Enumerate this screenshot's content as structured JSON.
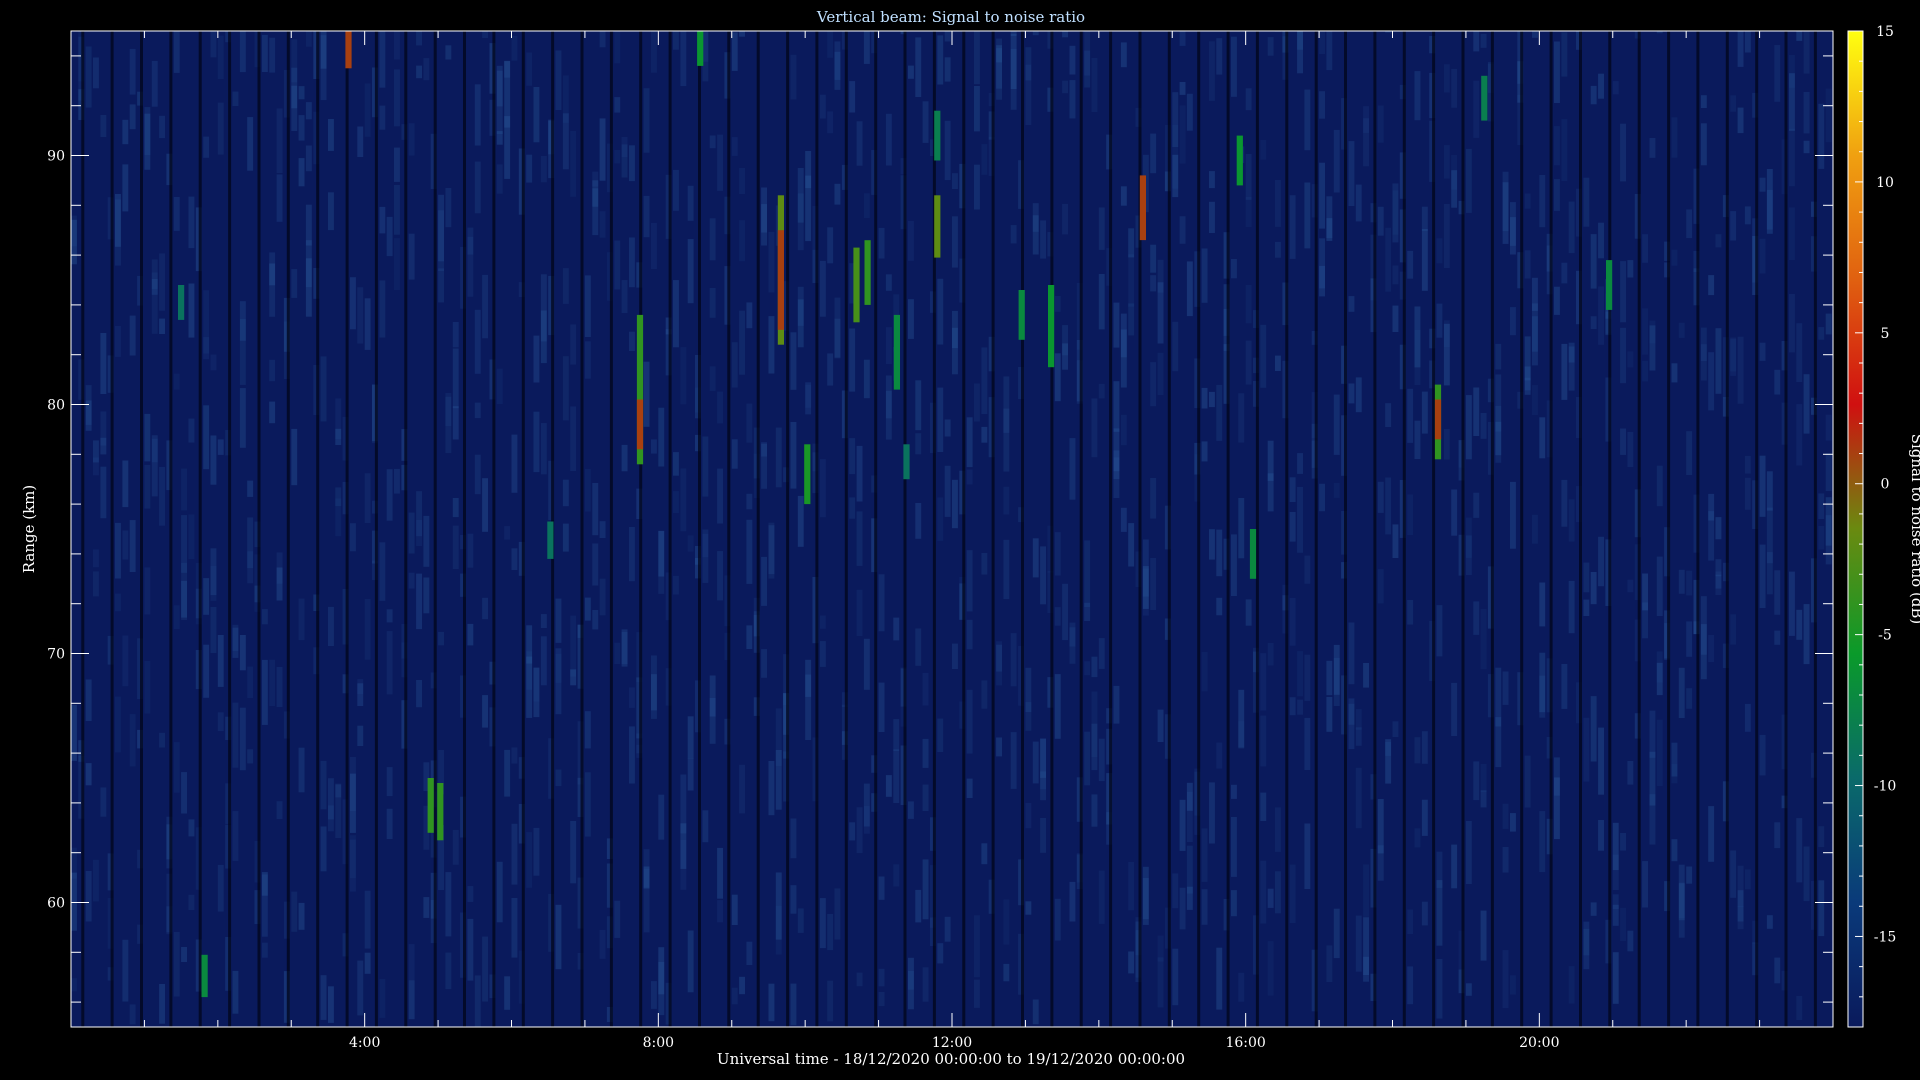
{
  "chart_data": {
    "type": "heatmap",
    "title": "Vertical beam: Signal to noise ratio",
    "xlabel": "Universal time - 18/12/2020 00:00:00 to 19/12/2020 00:00:00",
    "ylabel": "Range (km)",
    "colorbar_label": "Signal to noise ratio (dB)",
    "x_unit": "hours UT",
    "xlim": [
      0,
      24
    ],
    "ylim": [
      55,
      95
    ],
    "x_ticks": [
      {
        "value": 4,
        "label": "4:00"
      },
      {
        "value": 8,
        "label": "8:00"
      },
      {
        "value": 12,
        "label": "12:00"
      },
      {
        "value": 16,
        "label": "16:00"
      },
      {
        "value": 20,
        "label": "20:00"
      }
    ],
    "y_ticks": [
      {
        "value": 60,
        "label": "60"
      },
      {
        "value": 70,
        "label": "70"
      },
      {
        "value": 80,
        "label": "80"
      },
      {
        "value": 90,
        "label": "90"
      }
    ],
    "colorbar_range": [
      -18,
      15
    ],
    "colorbar_ticks": [
      {
        "value": 15,
        "label": "15"
      },
      {
        "value": 10,
        "label": "10"
      },
      {
        "value": 5,
        "label": "5"
      },
      {
        "value": 0,
        "label": "0"
      },
      {
        "value": -5,
        "label": "-5"
      },
      {
        "value": -10,
        "label": "-10"
      },
      {
        "value": -15,
        "label": "-15"
      }
    ],
    "colormap": [
      "#0a1a5c",
      "#0a3a7a",
      "#0a6a6a",
      "#0a9a2a",
      "#6a8a10",
      "#d01010",
      "#e06010",
      "#f0a010",
      "#ffff10"
    ],
    "colors": {
      "background": "#000000",
      "axes": "#ffffff",
      "title": "#c0e0ff",
      "base": "#0a1a5c"
    },
    "echoes": [
      {
        "time": 3.78,
        "range_min": 93.5,
        "range_max": 95.0,
        "snr_db": 1
      },
      {
        "time": 8.57,
        "range_min": 93.6,
        "range_max": 95.0,
        "snr_db": -6
      },
      {
        "time": 1.82,
        "range_min": 56.2,
        "range_max": 57.9,
        "snr_db": -7
      },
      {
        "time": 1.5,
        "range_min": 83.4,
        "range_max": 84.8,
        "snr_db": -9
      },
      {
        "time": 4.9,
        "range_min": 62.8,
        "range_max": 65.0,
        "snr_db": -4
      },
      {
        "time": 5.03,
        "range_min": 62.5,
        "range_max": 64.8,
        "snr_db": -4
      },
      {
        "time": 6.53,
        "range_min": 73.8,
        "range_max": 75.3,
        "snr_db": -9
      },
      {
        "time": 7.75,
        "range_min": 77.6,
        "range_max": 83.6,
        "snr_db": -4
      },
      {
        "time": 7.75,
        "range_min": 78.2,
        "range_max": 80.2,
        "snr_db": 1
      },
      {
        "time": 9.67,
        "range_min": 82.4,
        "range_max": 88.4,
        "snr_db": -2
      },
      {
        "time": 9.67,
        "range_min": 83.0,
        "range_max": 87.0,
        "snr_db": 1
      },
      {
        "time": 10.03,
        "range_min": 76.0,
        "range_max": 78.4,
        "snr_db": -5
      },
      {
        "time": 10.7,
        "range_min": 83.3,
        "range_max": 86.3,
        "snr_db": -3
      },
      {
        "time": 10.85,
        "range_min": 84.0,
        "range_max": 86.6,
        "snr_db": -4
      },
      {
        "time": 11.25,
        "range_min": 80.6,
        "range_max": 83.6,
        "snr_db": -7
      },
      {
        "time": 11.38,
        "range_min": 77.0,
        "range_max": 78.4,
        "snr_db": -9
      },
      {
        "time": 11.8,
        "range_min": 85.9,
        "range_max": 88.4,
        "snr_db": -2
      },
      {
        "time": 11.8,
        "range_min": 89.8,
        "range_max": 91.8,
        "snr_db": -8
      },
      {
        "time": 12.95,
        "range_min": 82.6,
        "range_max": 84.6,
        "snr_db": -7
      },
      {
        "time": 13.35,
        "range_min": 81.5,
        "range_max": 84.8,
        "snr_db": -6
      },
      {
        "time": 14.6,
        "range_min": 86.6,
        "range_max": 89.2,
        "snr_db": 1
      },
      {
        "time": 15.92,
        "range_min": 88.8,
        "range_max": 90.8,
        "snr_db": -6
      },
      {
        "time": 16.1,
        "range_min": 73.0,
        "range_max": 75.0,
        "snr_db": -7
      },
      {
        "time": 18.62,
        "range_min": 77.8,
        "range_max": 80.8,
        "snr_db": -4
      },
      {
        "time": 18.62,
        "range_min": 78.6,
        "range_max": 80.2,
        "snr_db": 1
      },
      {
        "time": 19.25,
        "range_min": 91.4,
        "range_max": 93.2,
        "snr_db": -8
      },
      {
        "time": 20.95,
        "range_min": 83.8,
        "range_max": 85.8,
        "snr_db": -7
      }
    ]
  }
}
